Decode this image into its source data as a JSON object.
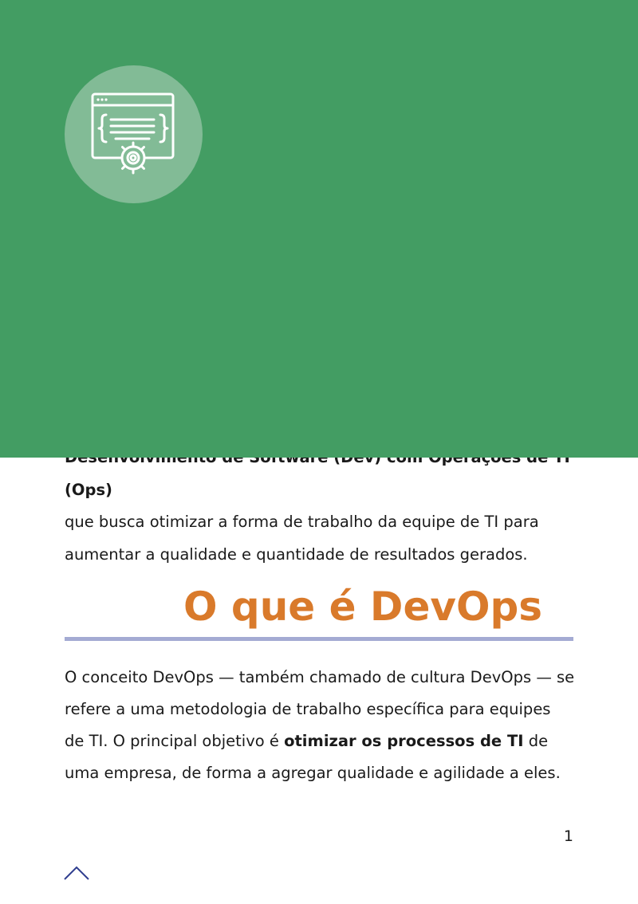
{
  "intro": {
    "line_1": "Desenvolvimento de Software (Dev) com Operações de TI (Ops)",
    "line_2": "que busca otimizar a forma de trabalho da equipe de TI para",
    "line_3": "aumentar a qualidade e quantidade de resultados gerados."
  },
  "banner": {
    "color": "#439d63",
    "logo_icon": "code-window-gear-icon"
  },
  "section": {
    "title": "O que é DevOps",
    "title_color": "#d97a2b",
    "rule_color": "#a4abd3",
    "para_part_1": "O conceito DevOps — também chamado de cultura DevOps — se refere a uma metodologia de trabalho específica para equipes de TI. O principal objetivo é ",
    "para_bold": "otimizar os processos de TI",
    "para_part_2": " de uma empresa, de forma a agregar qualidade e agilidade a eles."
  },
  "footer": {
    "page_number": "1",
    "nav_icon": "chevron-up-icon"
  }
}
